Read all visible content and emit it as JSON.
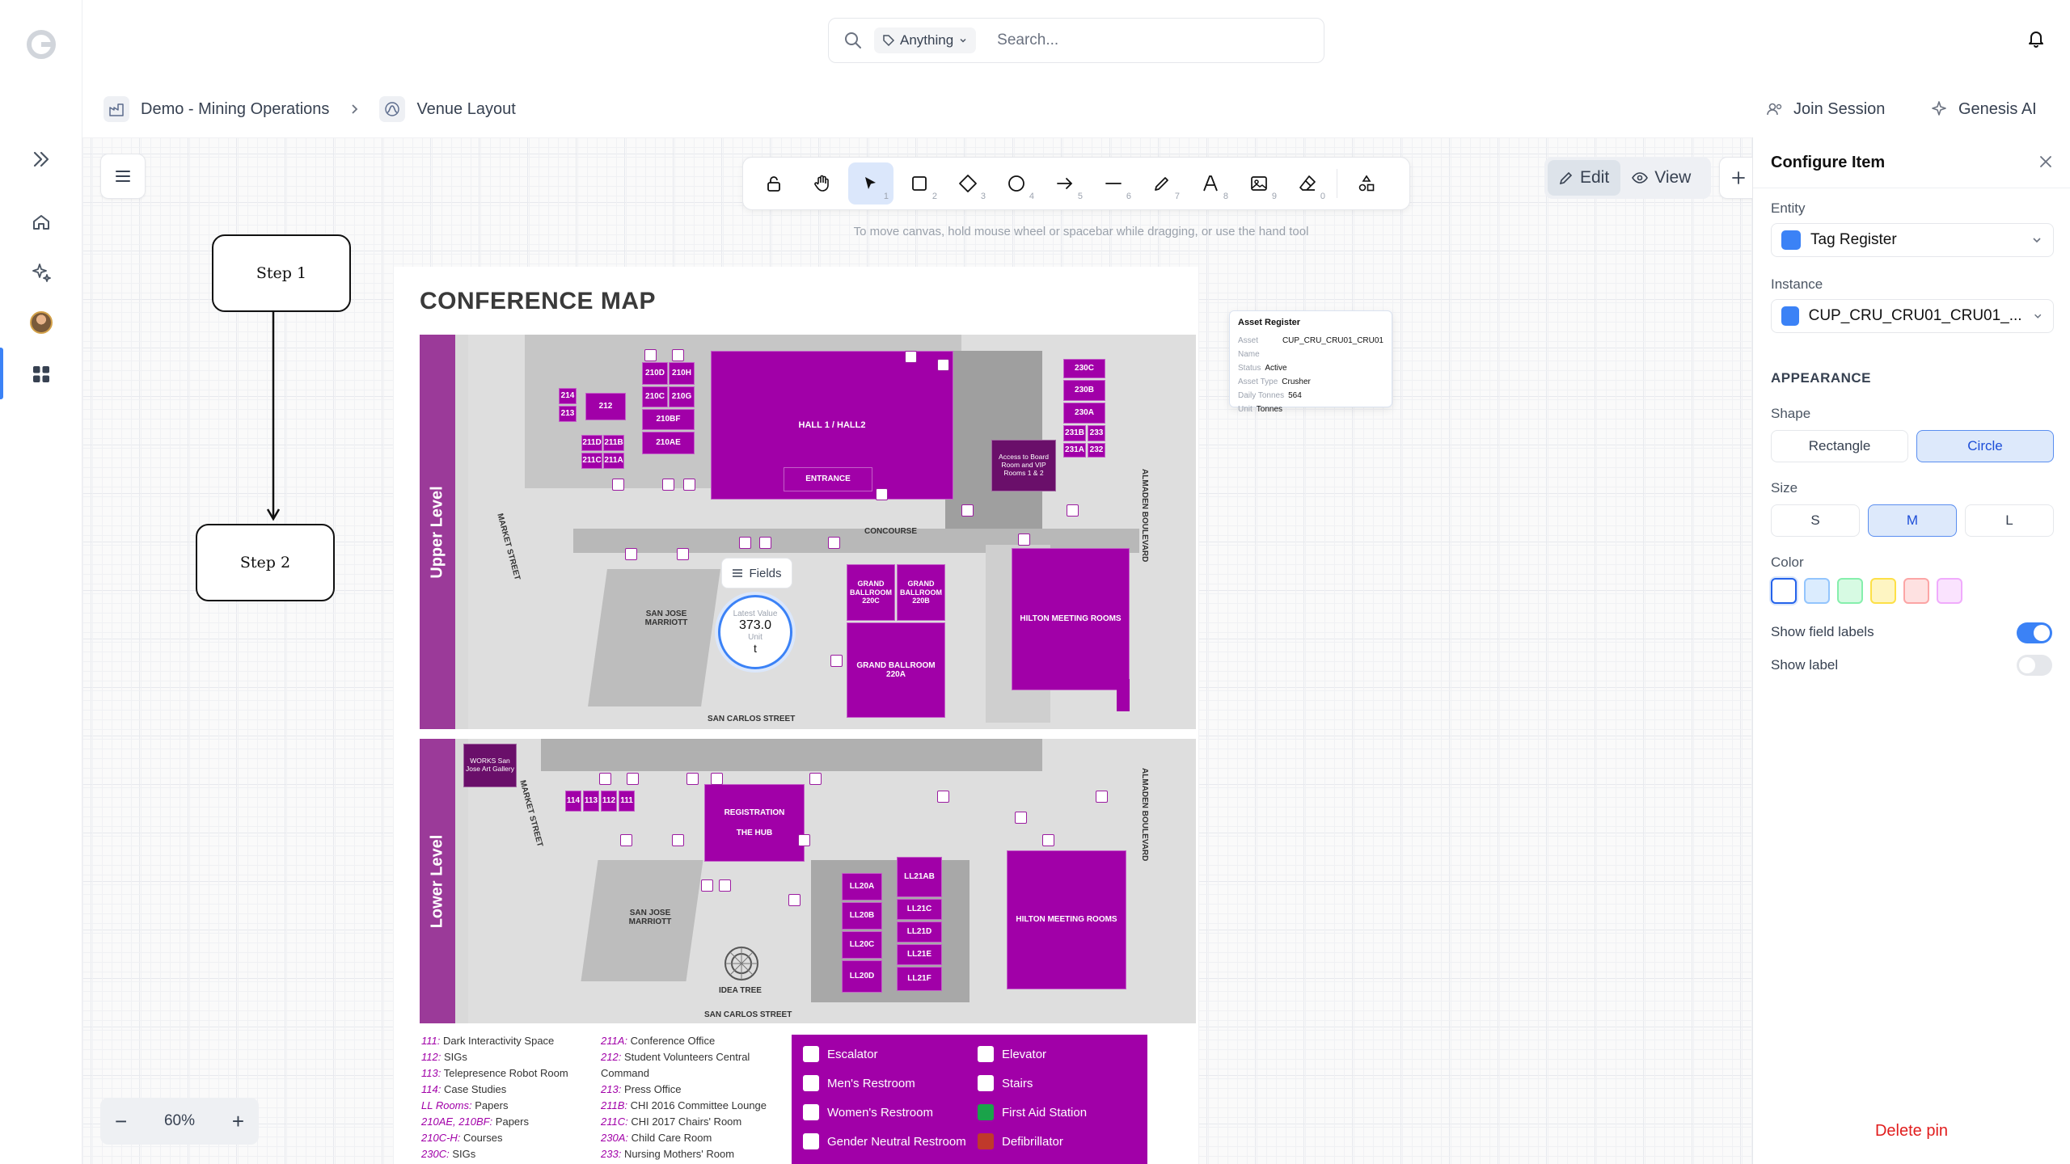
{
  "search": {
    "scope": "Anything",
    "placeholder": "Search..."
  },
  "breadcrumb": {
    "project": "Demo - Mining Operations",
    "page": "Venue Layout"
  },
  "actions": {
    "join": "Join Session",
    "ai": "Genesis AI"
  },
  "toolbar": {
    "numbers": [
      "1",
      "2",
      "3",
      "4",
      "5",
      "6",
      "7",
      "8",
      "9",
      "0"
    ],
    "hint": "To move canvas, hold mouse wheel or spacebar while dragging, or use the hand tool"
  },
  "mode": {
    "edit": "Edit",
    "view": "View"
  },
  "flow": {
    "step1": "Step 1",
    "step2": "Step 2"
  },
  "map": {
    "title": "CONFERENCE MAP",
    "upper_label": "Upper Level",
    "lower_label": "Lower Level",
    "upper_rooms": {
      "r214": "214",
      "r213": "213",
      "r212": "212",
      "r210d": "210D",
      "r210h": "210H",
      "r210c": "210C",
      "r210g": "210G",
      "r210bf": "210BF",
      "r210ae": "210AE",
      "r211d": "211D",
      "r211b": "211B",
      "r211c": "211C",
      "r211a": "211A",
      "hall": "HALL 1 / HALL2",
      "entrance": "ENTRANCE",
      "access": "Access to Board Room and VIP Rooms 1 & 2",
      "r230c": "230C",
      "r230b": "230B",
      "r230a": "230A",
      "r231b": "231B",
      "r233": "233",
      "r231a": "231A",
      "r232": "232",
      "gb220c": "GRAND BALLROOM 220C",
      "gb220b": "GRAND BALLROOM 220B",
      "gb220a": "GRAND BALLROOM 220A",
      "hilton": "HILTON MEETING ROOMS",
      "concourse": "CONCOURSE",
      "marriott": "SAN JOSE MARRIOTT",
      "market": "MARKET STREET",
      "almaden": "ALMADEN BOULEVARD",
      "sancarlos": "SAN CARLOS STREET"
    },
    "lower_rooms": {
      "works": "WORKS San Jose Art Gallery",
      "r114": "114",
      "r113": "113",
      "r112": "112",
      "r111": "111",
      "registration": "REGISTRATION",
      "hub": "THE HUB",
      "ll20a": "LL20A",
      "ll20b": "LL20B",
      "ll20c": "LL20C",
      "ll20d": "LL20D",
      "ll21ab": "LL21AB",
      "ll21c": "LL21C",
      "ll21d": "LL21D",
      "ll21e": "LL21E",
      "ll21f": "LL21F",
      "hilton": "HILTON MEETING ROOMS",
      "marriott": "SAN JOSE MARRIOTT",
      "ideatree": "IDEA TREE",
      "market": "MARKET STREET",
      "almaden": "ALMADEN BOULEVARD",
      "sancarlos": "SAN CARLOS STREET"
    },
    "legend_left": [
      {
        "k": "111:",
        "v": "Dark Interactivity Space"
      },
      {
        "k": "112:",
        "v": "SIGs"
      },
      {
        "k": "113:",
        "v": "Telepresence Robot Room"
      },
      {
        "k": "114:",
        "v": "Case Studies"
      },
      {
        "k": "LL Rooms:",
        "v": "Papers"
      },
      {
        "k": "210AE, 210BF:",
        "v": "Papers"
      },
      {
        "k": "210C-H:",
        "v": "Courses"
      },
      {
        "k": "230C:",
        "v": "SIGs"
      }
    ],
    "legend_mid": [
      {
        "k": "211A:",
        "v": "Conference Office"
      },
      {
        "k": "212:",
        "v": "Student Volunteers Central Command"
      },
      {
        "k": "213:",
        "v": "Press Office"
      },
      {
        "k": "211B:",
        "v": "CHI 2016 Committee Lounge"
      },
      {
        "k": "211C:",
        "v": "CHI 2017 Chairs' Room"
      },
      {
        "k": "230A:",
        "v": "Child Care Room"
      },
      {
        "k": "233:",
        "v": "Nursing Mothers' Room"
      }
    ],
    "legend_icons": [
      "Escalator",
      "Men's Restroom",
      "Women's Restroom",
      "Gender Neutral Restroom",
      "Elevator",
      "Stairs",
      "First Aid Station",
      "Defibrillator"
    ]
  },
  "popover": {
    "title": "Asset Register",
    "rows": [
      {
        "k": "Asset Name",
        "v": "CUP_CRU_CRU01_CRU01"
      },
      {
        "k": "Status",
        "v": "Active"
      },
      {
        "k": "Asset Type",
        "v": "Crusher"
      },
      {
        "k": "Daily Tonnes",
        "v": "564"
      },
      {
        "k": "Unit",
        "v": "Tonnes"
      }
    ]
  },
  "pin": {
    "fields_label": "Fields",
    "latest_label": "Latest Value",
    "value": "373.0",
    "unit_label": "Unit",
    "unit": "t"
  },
  "zoom": {
    "level": "60%"
  },
  "panel": {
    "title": "Configure Item",
    "entity_label": "Entity",
    "entity": "Tag Register",
    "instance_label": "Instance",
    "instance": "CUP_CRU_CRU01_CRU01_...",
    "appearance": "APPEARANCE",
    "shape_label": "Shape",
    "shape_options": [
      "Rectangle",
      "Circle"
    ],
    "shape_selected": "Circle",
    "size_label": "Size",
    "size_options": [
      "S",
      "M",
      "L"
    ],
    "size_selected": "M",
    "color_label": "Color",
    "colors": [
      "#2563eb",
      "#93c5fd",
      "#86efac",
      "#fde047",
      "#fca5a5",
      "#f0abfc"
    ],
    "show_field_labels": "Show field labels",
    "show_field_labels_on": true,
    "show_label": "Show label",
    "show_label_on": false,
    "delete": "Delete pin"
  },
  "colors": {
    "accent": "#3b82f6",
    "map_purple": "#a100a8",
    "band": "#9b3a99",
    "danger": "#e11d1d"
  }
}
